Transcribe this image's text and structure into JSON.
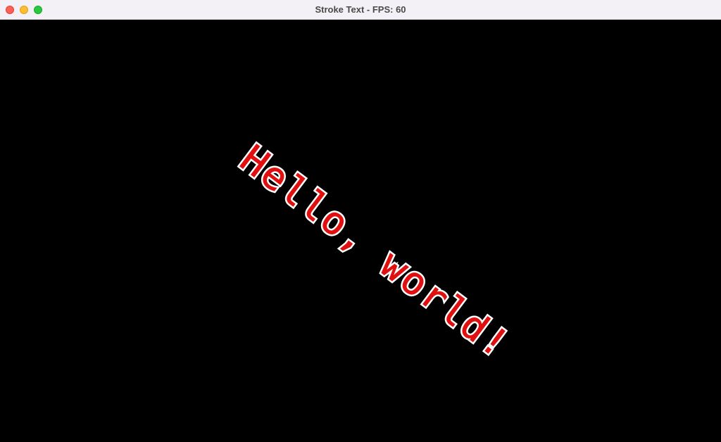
{
  "window": {
    "title": "Stroke Text - FPS: 60"
  },
  "canvas": {
    "background_color": "#000000",
    "text": "Hello, world!",
    "text_fill_color": "#e01010",
    "text_stroke_color": "#ffffff"
  }
}
